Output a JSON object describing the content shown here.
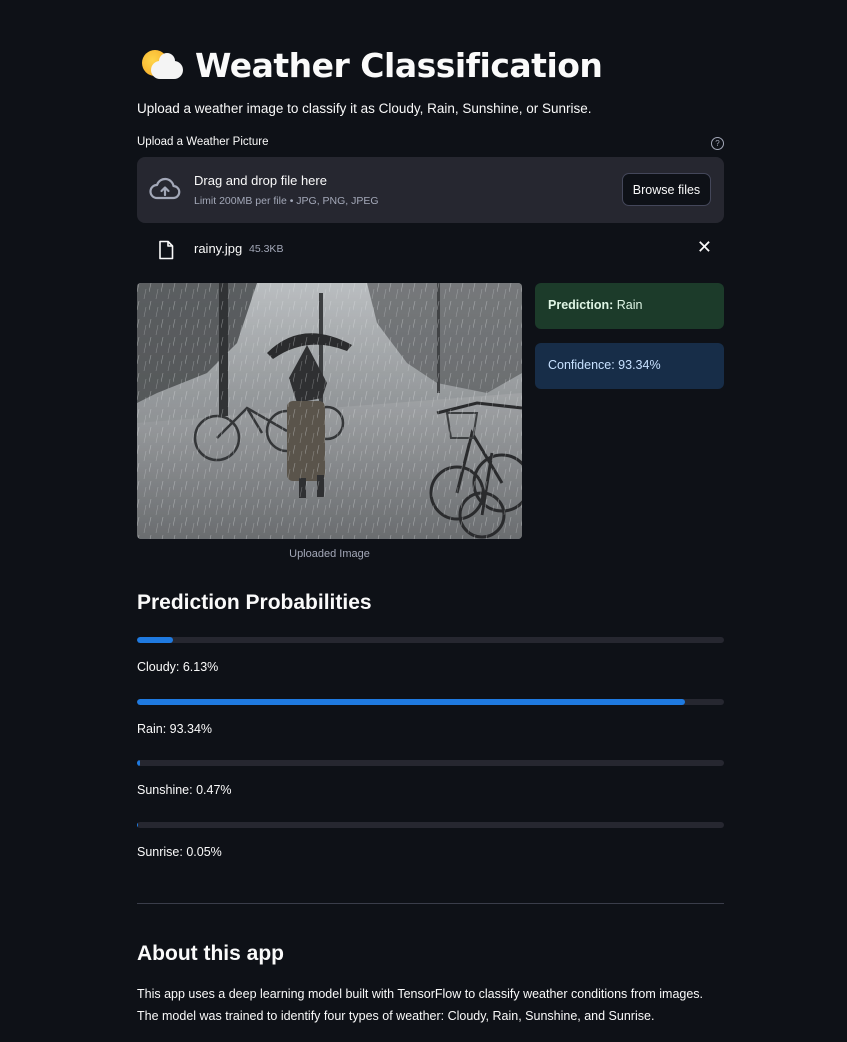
{
  "header": {
    "title": "Weather Classification",
    "title_icon": "sun-behind-cloud-icon",
    "subtitle": "Upload a weather image to classify it as Cloudy, Rain, Sunshine, or Sunrise."
  },
  "uploader": {
    "label": "Upload a Weather Picture",
    "help_icon": "?",
    "dropzone_title": "Drag and drop file here",
    "dropzone_limit": "Limit 200MB per file • JPG, PNG, JPEG",
    "browse_label": "Browse files",
    "file_name": "rainy.jpg",
    "file_size": "45.3KB",
    "remove_symbol": "✕"
  },
  "image": {
    "caption": "Uploaded Image"
  },
  "result": {
    "prediction_label": "Prediction:",
    "prediction_value": "Rain",
    "confidence_text": "Confidence: 93.34%",
    "success_color": "#1c3b2a",
    "info_color": "#172d48"
  },
  "probabilities": {
    "title": "Prediction Probabilities",
    "accent": "#1f7ae0",
    "items": [
      {
        "label": "Cloudy: 6.13%",
        "value": 6.13
      },
      {
        "label": "Rain: 93.34%",
        "value": 93.34
      },
      {
        "label": "Sunshine: 0.47%",
        "value": 0.47
      },
      {
        "label": "Sunrise: 0.05%",
        "value": 0.05
      }
    ]
  },
  "about": {
    "title": "About this app",
    "line1": "This app uses a deep learning model built with TensorFlow to classify weather conditions from images.",
    "line2": "The model was trained to identify four types of weather: Cloudy, Rain, Sunshine, and Sunrise."
  }
}
